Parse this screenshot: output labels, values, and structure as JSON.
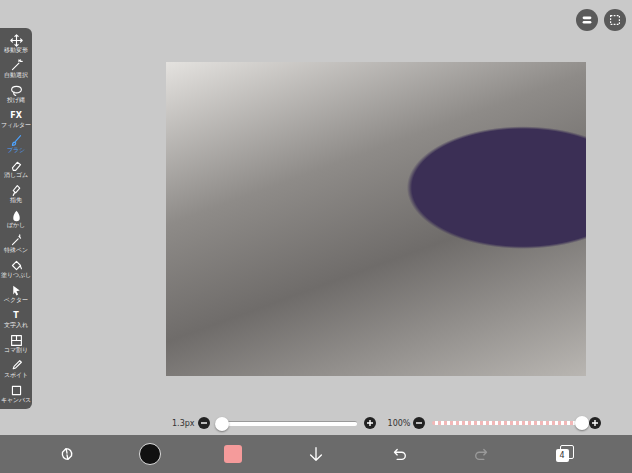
{
  "toolbar": {
    "items": [
      {
        "label": "移動変形",
        "selected": false
      },
      {
        "label": "自動選択",
        "selected": false
      },
      {
        "label": "投げ縄",
        "selected": false
      },
      {
        "label": "フィルター",
        "glyph": "FX",
        "selected": false
      },
      {
        "label": "ブラシ",
        "selected": true
      },
      {
        "label": "消しゴム",
        "selected": false
      },
      {
        "label": "指先",
        "selected": false
      },
      {
        "label": "ぼかし",
        "selected": false
      },
      {
        "label": "特殊ペン",
        "selected": false
      },
      {
        "label": "塗りつぶし",
        "selected": false
      },
      {
        "label": "ベクター",
        "selected": false
      },
      {
        "label": "文字入れ",
        "glyph": "T",
        "selected": false
      },
      {
        "label": "コマ割り",
        "selected": false
      },
      {
        "label": "スポイト",
        "selected": false
      },
      {
        "label": "キャンバス",
        "selected": false
      }
    ]
  },
  "sliders": [
    {
      "name": "brush-size",
      "kind": "size",
      "reading": "1.3px",
      "level": 0.04
    },
    {
      "name": "opacity",
      "kind": "opacity",
      "reading": "100%",
      "level": 1.0
    }
  ],
  "bottom_bar": {
    "primary_color": "#111111",
    "secondary_color": "#f59b9b",
    "undo_disabled": false,
    "redo_disabled": true,
    "layer_count": "4"
  }
}
